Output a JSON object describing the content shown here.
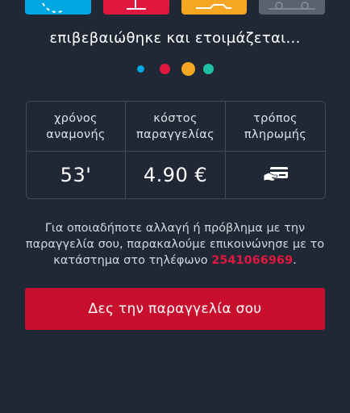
{
  "steps": [
    {
      "icon": "timer-icon",
      "color": "#00a8e1"
    },
    {
      "icon": "store-icon",
      "color": "#e0173f"
    },
    {
      "icon": "dish-icon",
      "color": "#f5a623"
    },
    {
      "icon": "delivery-icon",
      "color": "#5a6270"
    }
  ],
  "status": {
    "text": "επιβεβαιώθηκε και ετοιμάζεται..."
  },
  "progress_dots": [
    "#00a8e1",
    "#e0173f",
    "#f5a623",
    "#1fbfa3"
  ],
  "order_info": {
    "wait_time_label": "χρόνος αναμονής",
    "wait_time_value": "53'",
    "cost_label": "κόστος παραγγελίας",
    "cost_value": "4.90 €",
    "payment_label": "τρόπος πληρωμής",
    "payment_icon": "card-payment-icon"
  },
  "notice": {
    "text": "Για οποιαδήποτε αλλαγή ή πρόβλημα με την παραγγελία σου, παρακαλούμε επικοινώνησε με το κατάστημα στο τηλέφωνο ",
    "phone": "2541066969",
    "end": "."
  },
  "cta": {
    "label": "Δες την παραγγελία σου"
  },
  "colors": {
    "background": "#1f2834",
    "accent_red": "#c8102e",
    "border": "#3f4957"
  }
}
